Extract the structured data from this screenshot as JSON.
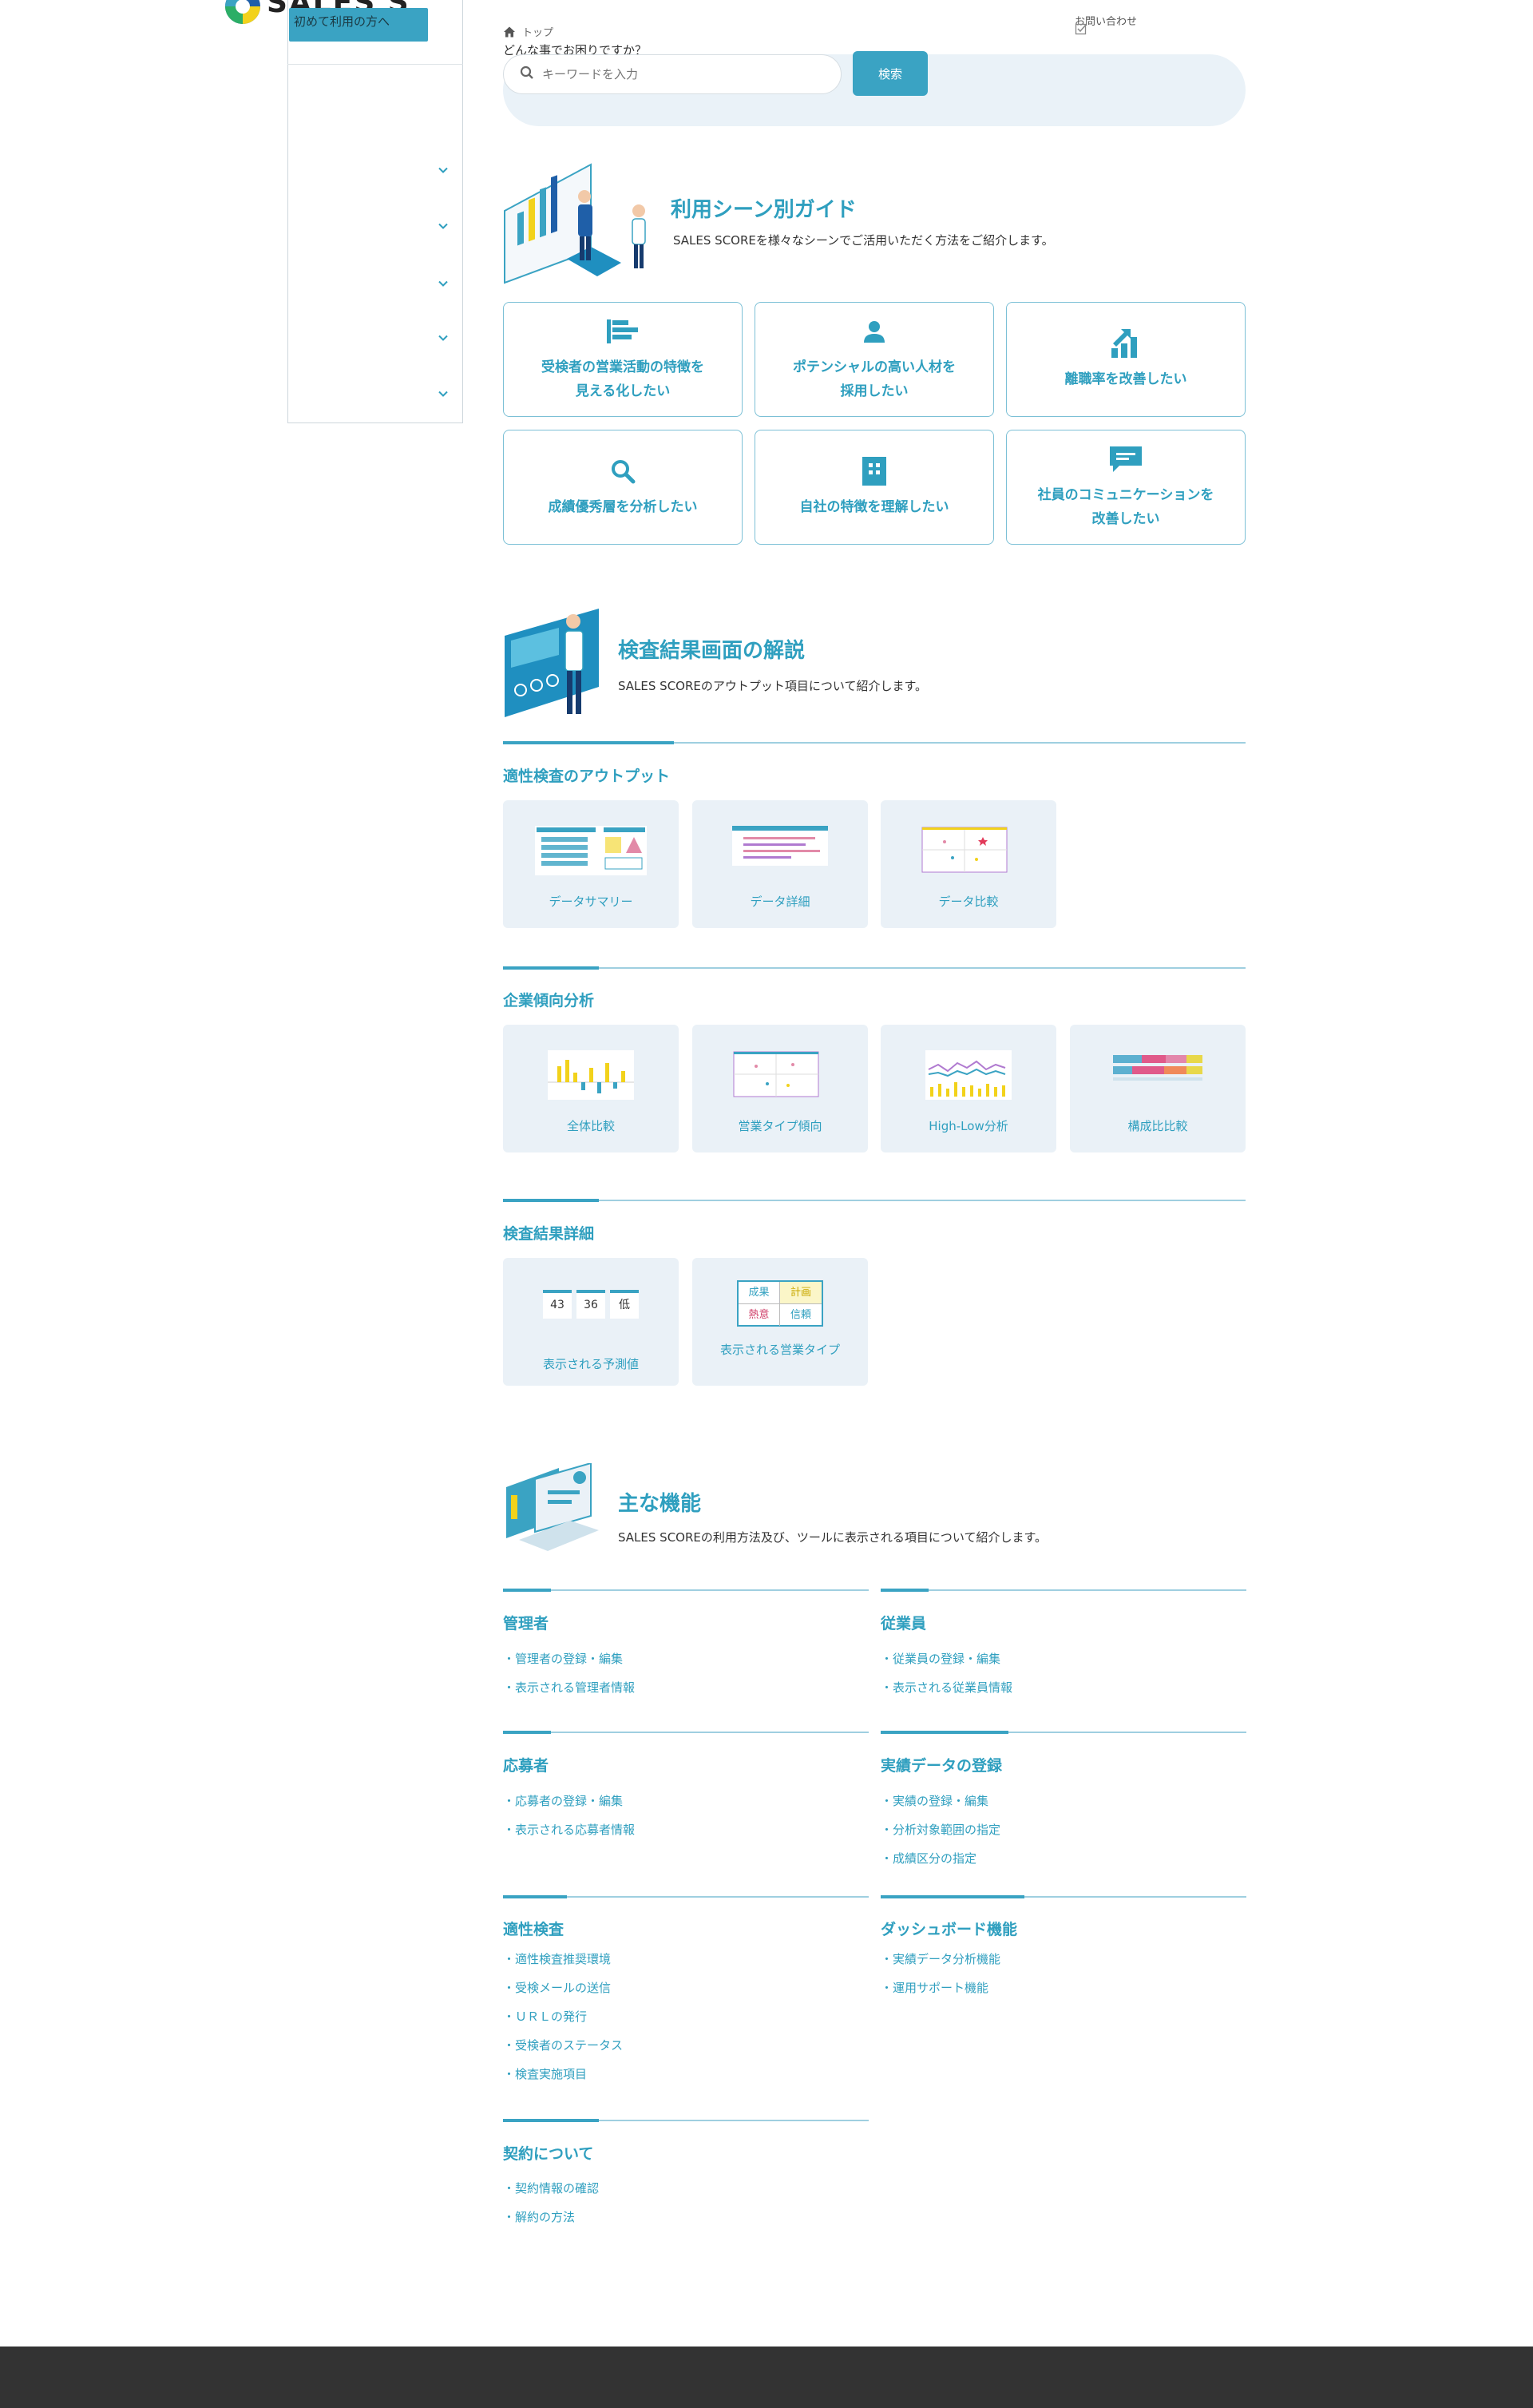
{
  "header": {
    "logo_text": "SALES S",
    "first_time_button": "初めて利用の方へ",
    "contact_label": "お問い合わせ"
  },
  "colors": {
    "accent": "#3aa3c3",
    "heading": "#2f9fbf",
    "panel": "#eaf2f8",
    "card_bg": "#eaf1f7",
    "footer": "#333333"
  },
  "breadcrumb": {
    "home_label": "トップ"
  },
  "search": {
    "question": "どんな事でお困りですか？",
    "placeholder": "キーワードを入力",
    "button_label": "検索"
  },
  "guide": {
    "title": "利用シーン別ガイド",
    "description": "SALES SCOREを様々なシーンでご活用いただく方法をご紹介します。",
    "cards": [
      {
        "label": "受検者の営業活動の特徴を\n見える化したい",
        "icon": "bar-chart-icon"
      },
      {
        "label": "ポテンシャルの高い人材を\n採用したい",
        "icon": "person-icon"
      },
      {
        "label": "離職率を改善したい",
        "icon": "growth-chart-icon"
      },
      {
        "label": "成績優秀層を分析したい",
        "icon": "magnifier-icon"
      },
      {
        "label": "自社の特徴を理解したい",
        "icon": "building-icon"
      },
      {
        "label": "社員のコミュニケーションを\n改善したい",
        "icon": "chat-icon"
      }
    ]
  },
  "results": {
    "title": "検査結果画面の解説",
    "description": "SALES SCOREのアウトプット項目について紹介します。",
    "groups": [
      {
        "title": "適性検査のアウトプット",
        "cards": [
          "データサマリー",
          "データ詳細",
          "データ比較"
        ]
      },
      {
        "title": "企業傾向分析",
        "cards": [
          "全体比較",
          "営業タイプ傾向",
          "High-Low分析",
          "構成比比較"
        ]
      },
      {
        "title": "検査結果詳細",
        "cards": [
          "表示される予測値",
          "表示される営業タイプ"
        ]
      }
    ],
    "thumb_texts": {
      "predicted": [
        "43",
        "36",
        "低"
      ],
      "types": [
        "成果",
        "計画",
        "熱意",
        "信頼"
      ]
    }
  },
  "features": {
    "title": "主な機能",
    "description": "SALES SCOREの利用方法及び、ツールに表示される項目について紹介します。",
    "groups": [
      {
        "title": "管理者",
        "links": [
          "・管理者の登録・編集",
          "・表示される管理者情報"
        ]
      },
      {
        "title": "従業員",
        "links": [
          "・従業員の登録・編集",
          "・表示される従業員情報"
        ]
      },
      {
        "title": "応募者",
        "links": [
          "・応募者の登録・編集",
          "・表示される応募者情報"
        ]
      },
      {
        "title": "実績データの登録",
        "links": [
          "・実績の登録・編集",
          "・分析対象範囲の指定",
          "・成績区分の指定"
        ]
      },
      {
        "title": "適性検査",
        "links": [
          "・適性検査推奨環境",
          "・受検メールの送信",
          "・ＵＲＬの発行",
          "・受検者のステータス",
          "・検査実施項目"
        ]
      },
      {
        "title": "ダッシュボード機能",
        "links": [
          "・実績データ分析機能",
          "・運用サポート機能"
        ]
      },
      {
        "title": "契約について",
        "links": [
          "・契約情報の確認",
          "・解約の方法"
        ]
      }
    ]
  }
}
